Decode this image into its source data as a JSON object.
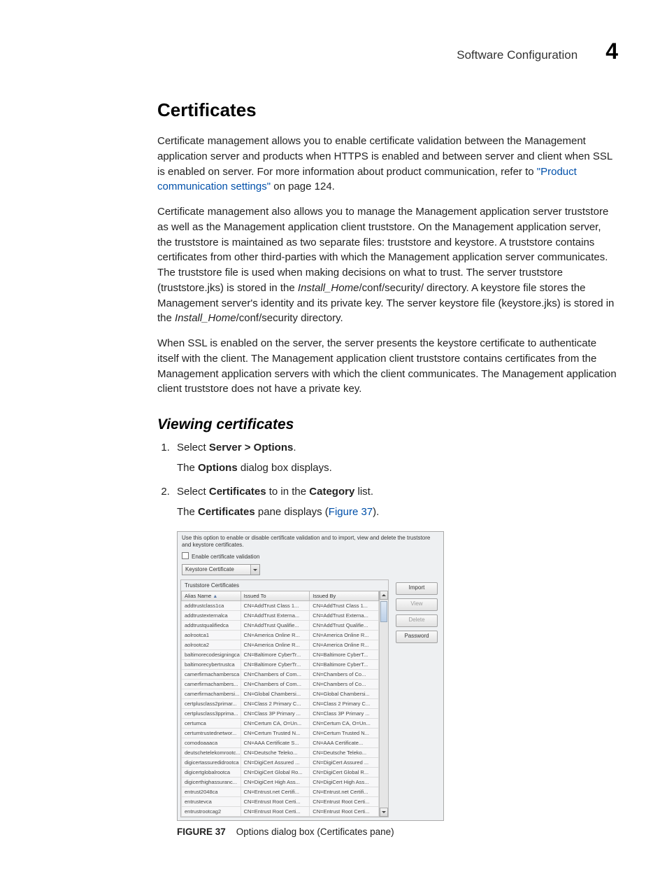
{
  "header": {
    "title": "Software Configuration",
    "chapter": "4"
  },
  "heading": "Certificates",
  "para1a": "Certificate management allows you to enable certificate validation between the Management application server and products when HTTPS is enabled and between server and client when SSL is enabled on server. For more information about product communication, refer to ",
  "para1_link": "\"Product communication settings\"",
  "para1b": " on page 124.",
  "para2a": "Certificate management also allows you to manage the Management application server truststore as well as the Management application client truststore. On the Management application server, the truststore is maintained as two separate files: truststore and keystore. A truststore contains certificates from other third-parties with which the Management application server communicates. The truststore file is used when making decisions on what to trust. The server truststore (truststore.jks) is stored in the ",
  "para2_ital1": "Install_Home",
  "para2b": "/conf/security/ directory. A keystore file stores the Management server's identity and its private key. The server keystore file (keystore.jks) is stored in the ",
  "para2_ital2": "Install_Home",
  "para2c": "/conf/security directory.",
  "para3": "When SSL is enabled on the server, the server presents the keystore certificate to authenticate itself with the client. The Management application client truststore contains certificates from the Management application servers with which the client communicates. The Management application client truststore does not have a private key.",
  "subheading": "Viewing certificates",
  "step1": {
    "pre": "Select ",
    "bold": "Server > Options",
    "post": ".",
    "sub_pre": "The ",
    "sub_bold": "Options",
    "sub_post": " dialog box displays."
  },
  "step2": {
    "pre": "Select ",
    "bold1": "Certificates",
    "mid": " to in the ",
    "bold2": "Category",
    "post": " list.",
    "sub_pre": "The ",
    "sub_bold": "Certificates",
    "sub_mid": " pane displays (",
    "sub_link": "Figure 37",
    "sub_post": ")."
  },
  "dialog": {
    "intro": "Use this option to enable or disable certificate validation and to import, view and delete the truststore and keystore certificates.",
    "checkbox_label": "Enable certificate validation",
    "dropdown_value": "Keystore Certificate",
    "panel_title": "Truststore Certificates",
    "columns": {
      "c1": "Alias Name",
      "c2": "Issued To",
      "c3": "Issued By"
    },
    "buttons": {
      "import": "Import",
      "view": "View",
      "delete": "Delete",
      "password": "Password"
    },
    "rows": [
      {
        "a": "addtrustclass1ca",
        "b": "CN=AddTrust Class 1...",
        "c": "CN=AddTrust Class 1..."
      },
      {
        "a": "addtrustexternalca",
        "b": "CN=AddTrust Externa...",
        "c": "CN=AddTrust Externa..."
      },
      {
        "a": "addtrustqualifiedca",
        "b": "CN=AddTrust Qualifie...",
        "c": "CN=AddTrust Qualifie..."
      },
      {
        "a": "aolrootca1",
        "b": "CN=America Online R...",
        "c": "CN=America Online R..."
      },
      {
        "a": "aolrootca2",
        "b": "CN=America Online R...",
        "c": "CN=America Online R..."
      },
      {
        "a": "baltimorecodesigningca",
        "b": "CN=Baltimore CyberTr...",
        "c": "CN=Baltimore CyberT..."
      },
      {
        "a": "baltimorecybertrustca",
        "b": "CN=Baltimore CyberTr...",
        "c": "CN=Baltimore CyberT..."
      },
      {
        "a": "camerfirmachambersca",
        "b": "CN=Chambers of Com...",
        "c": "CN=Chambers of Co..."
      },
      {
        "a": "camerfirmachambers...",
        "b": "CN=Chambers of Com...",
        "c": "CN=Chambers of Co..."
      },
      {
        "a": "camerfirmachambersi...",
        "b": "CN=Global Chambersi...",
        "c": "CN=Global Chambersi..."
      },
      {
        "a": "certplusclass2primar...",
        "b": "CN=Class 2 Primary C...",
        "c": "CN=Class 2 Primary C..."
      },
      {
        "a": "certplusclass3pprima...",
        "b": "CN=Class 3P Primary ...",
        "c": "CN=Class 3P Primary ..."
      },
      {
        "a": "certumca",
        "b": "CN=Certum CA, O=Un...",
        "c": "CN=Certum CA, O=Un..."
      },
      {
        "a": "certumtrustednetwor...",
        "b": "CN=Certum Trusted N...",
        "c": "CN=Certum Trusted N..."
      },
      {
        "a": "comodoaaaca",
        "b": "CN=AAA Certificate S...",
        "c": "CN=AAA Certificate..."
      },
      {
        "a": "deutschetelekomrootc...",
        "b": "CN=Deutsche Teleko...",
        "c": "CN=Deutsche Teleko..."
      },
      {
        "a": "digicertassuredidrootca",
        "b": "CN=DigiCert Assured ...",
        "c": "CN=DigiCert Assured ..."
      },
      {
        "a": "digicertglobalrootca",
        "b": "CN=DigiCert Global Ro...",
        "c": "CN=DigiCert Global R..."
      },
      {
        "a": "digicerthighassuranc...",
        "b": "CN=DigiCert High Ass...",
        "c": "CN=DigiCert High Ass..."
      },
      {
        "a": "entrust2048ca",
        "b": "CN=Entrust.net Certifi...",
        "c": "CN=Entrust.net Certifi..."
      },
      {
        "a": "entrustevca",
        "b": "CN=Entrust Root Certi...",
        "c": "CN=Entrust Root Certi..."
      },
      {
        "a": "entrustrootcag2",
        "b": "CN=Entrust Root Certi...",
        "c": "CN=Entrust Root Certi..."
      }
    ]
  },
  "figure": {
    "label": "FIGURE 37",
    "caption": "Options dialog box (Certificates pane)"
  }
}
